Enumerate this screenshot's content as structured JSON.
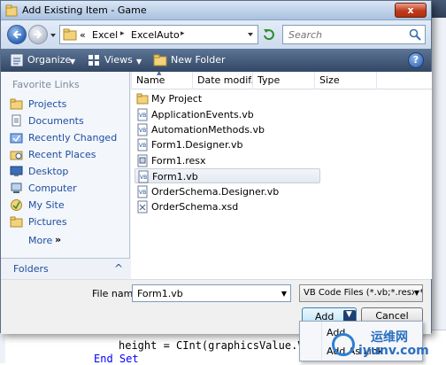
{
  "window": {
    "title": "Add Existing Item - Game",
    "close_label": "x"
  },
  "address": {
    "prefix": "«",
    "crumbs": [
      "Excel",
      "ExcelAuto"
    ],
    "separator": "▸",
    "search_placeholder": "Search"
  },
  "toolbar": {
    "organize_label": "Organize",
    "views_label": "Views",
    "new_folder_label": "New Folder",
    "help_label": "?"
  },
  "sidebar": {
    "header": "Favorite Links",
    "items": [
      {
        "label": "Projects",
        "icon": "folder-icon"
      },
      {
        "label": "Documents",
        "icon": "documents-icon"
      },
      {
        "label": "Recently Changed",
        "icon": "recently-changed-icon"
      },
      {
        "label": "Recent Places",
        "icon": "recent-places-icon"
      },
      {
        "label": "Desktop",
        "icon": "desktop-icon"
      },
      {
        "label": "Computer",
        "icon": "computer-icon"
      },
      {
        "label": "My Site",
        "icon": "my-site-icon"
      },
      {
        "label": "Pictures",
        "icon": "pictures-icon"
      }
    ],
    "more_label": "More",
    "more_chevron": "»",
    "folders_label": "Folders",
    "folders_chevron": "^"
  },
  "file_list": {
    "columns": [
      "Name",
      "Date modif...",
      "Type",
      "Size"
    ],
    "files": [
      {
        "name": "My Project",
        "icon": "folder-icon"
      },
      {
        "name": "ApplicationEvents.vb",
        "icon": "vb-file-icon"
      },
      {
        "name": "AutomationMethods.vb",
        "icon": "vb-file-icon"
      },
      {
        "name": "Form1.Designer.vb",
        "icon": "vb-file-icon"
      },
      {
        "name": "Form1.resx",
        "icon": "resx-file-icon"
      },
      {
        "name": "Form1.vb",
        "icon": "vb-file-icon",
        "selected": true
      },
      {
        "name": "OrderSchema.Designer.vb",
        "icon": "vb-file-icon"
      },
      {
        "name": "OrderSchema.xsd",
        "icon": "xsd-file-icon"
      }
    ]
  },
  "footer": {
    "file_name_label": "File name:",
    "file_name_value": "Form1.vb",
    "file_type_value": "VB Code Files (*.vb;*.resx;*.se",
    "add_label": "Add",
    "cancel_label": "Cancel"
  },
  "add_menu": {
    "items": [
      "Add",
      "Add As Link"
    ]
  },
  "code": {
    "line1_kw": "",
    "line1": "height = CInt(graphicsValue.V",
    "line2_kw": "End Set",
    "line3": ""
  },
  "watermark": {
    "cn_text": "运维网",
    "url_text": "iyunv.com"
  },
  "colors": {
    "toolbar": "#324764",
    "link": "#1e4ea0",
    "selection": "#e4e9f1"
  }
}
